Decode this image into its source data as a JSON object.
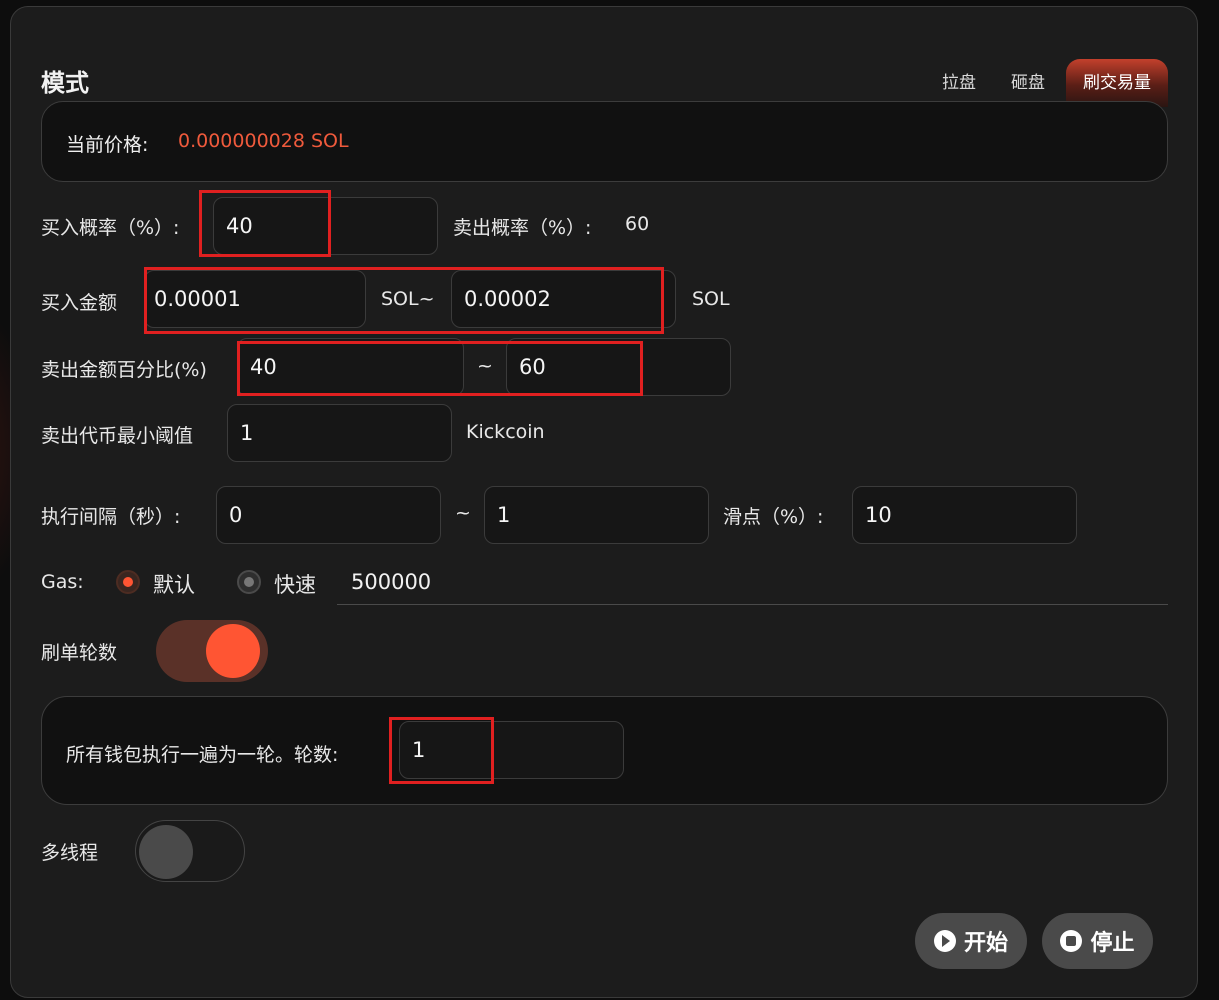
{
  "header": {
    "title": "模式",
    "tabs": [
      {
        "label": "拉盘",
        "active": false
      },
      {
        "label": "砸盘",
        "active": false
      },
      {
        "label": "刷交易量",
        "active": true
      }
    ]
  },
  "price": {
    "label": "当前价格:",
    "value": "0.000000028 SOL"
  },
  "buy_prob": {
    "label": "买入概率（%）:",
    "value": "40"
  },
  "sell_prob": {
    "label": "卖出概率（%）:",
    "value": "60"
  },
  "buy_amount": {
    "label": "买入金额",
    "min": "0.00001",
    "sep": "SOL~",
    "max": "0.00002",
    "unit": "SOL"
  },
  "sell_pct": {
    "label": "卖出金额百分比(%)",
    "min": "40",
    "sep": "~",
    "max": "60"
  },
  "sell_min": {
    "label": "卖出代币最小阈值",
    "value": "1",
    "unit": "Kickcoin"
  },
  "interval": {
    "label": "执行间隔（秒）:",
    "min": "0",
    "sep": "~",
    "max": "1"
  },
  "slippage": {
    "label": "滑点（%）:",
    "value": "10"
  },
  "gas": {
    "label": "Gas:",
    "option_default": "默认",
    "option_fast": "快速",
    "selected": "默认",
    "value": "500000"
  },
  "rounds": {
    "label": "刷单轮数",
    "enabled": true,
    "desc": "所有钱包执行一遍为一轮。轮数:",
    "value": "1"
  },
  "multithread": {
    "label": "多线程",
    "enabled": false
  },
  "actions": {
    "start": "开始",
    "stop": "停止"
  },
  "colors": {
    "accent": "#ff5533",
    "price": "#ef5a3c",
    "highlight": "#e02020",
    "panel": "#1c1c1c"
  }
}
